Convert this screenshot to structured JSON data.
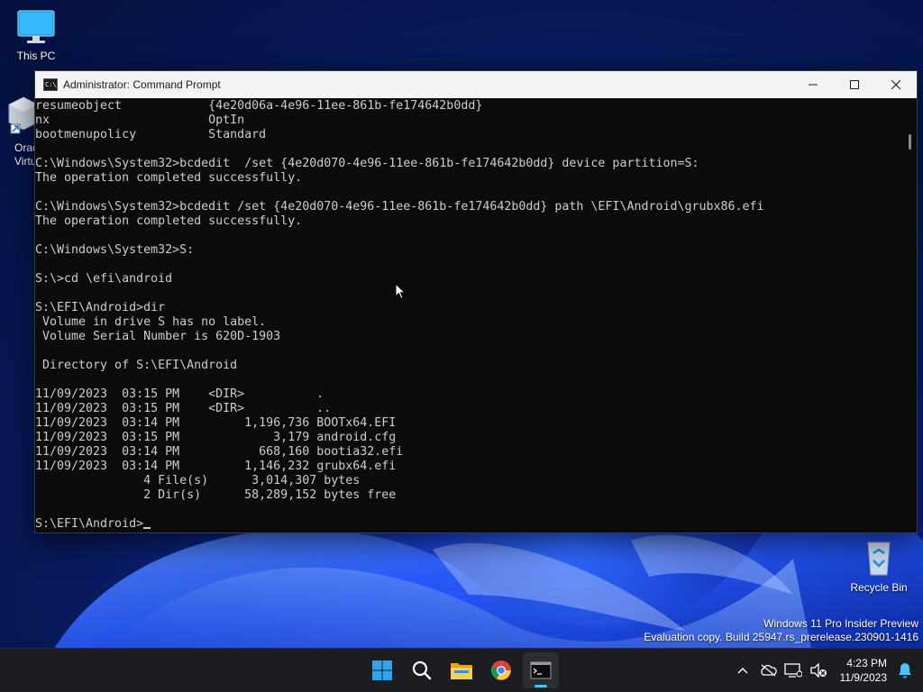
{
  "desktop": {
    "icons": [
      {
        "label": "This PC"
      },
      {
        "label": "Oracl\nVirtu"
      },
      {
        "label": "Recycle Bin"
      }
    ],
    "watermark": {
      "line1": "Windows 11 Pro Insider Preview",
      "line2": "Evaluation copy. Build 25947.rs_prerelease.230901-1416"
    }
  },
  "window": {
    "title": "Administrator: Command Prompt",
    "app_icon_text": "C:\\",
    "console_text": "resumeobject            {4e20d06a-4e96-11ee-861b-fe174642b0dd}\nnx                      OptIn\nbootmenupolicy          Standard\n\nC:\\Windows\\System32>bcdedit  /set {4e20d070-4e96-11ee-861b-fe174642b0dd} device partition=S:\nThe operation completed successfully.\n\nC:\\Windows\\System32>bcdedit /set {4e20d070-4e96-11ee-861b-fe174642b0dd} path \\EFI\\Android\\grubx86.efi\nThe operation completed successfully.\n\nC:\\Windows\\System32>S:\n\nS:\\>cd \\efi\\android\n\nS:\\EFI\\Android>dir\n Volume in drive S has no label.\n Volume Serial Number is 620D-1903\n\n Directory of S:\\EFI\\Android\n\n11/09/2023  03:15 PM    <DIR>          .\n11/09/2023  03:15 PM    <DIR>          ..\n11/09/2023  03:14 PM         1,196,736 BOOTx64.EFI\n11/09/2023  03:15 PM             3,179 android.cfg\n11/09/2023  03:14 PM           668,160 bootia32.efi\n11/09/2023  03:14 PM         1,146,232 grubx64.efi\n               4 File(s)      3,014,307 bytes\n               2 Dir(s)      58,289,152 bytes free\n\n",
    "prompt": "S:\\EFI\\Android>"
  },
  "taskbar": {
    "apps": [
      {
        "name": "Start",
        "icon": "windows-logo-icon"
      },
      {
        "name": "Search",
        "icon": "search-icon"
      },
      {
        "name": "File Explorer",
        "icon": "folder-icon"
      },
      {
        "name": "Google Chrome",
        "icon": "chrome-icon"
      },
      {
        "name": "Command Prompt",
        "icon": "terminal-icon",
        "active": true
      }
    ],
    "tray": {
      "time": "4:23 PM",
      "date": "11/9/2023"
    }
  },
  "colors": {
    "console_bg": "#0c0c0c",
    "console_fg": "#cccccc",
    "accent": "#4cc2ff"
  }
}
